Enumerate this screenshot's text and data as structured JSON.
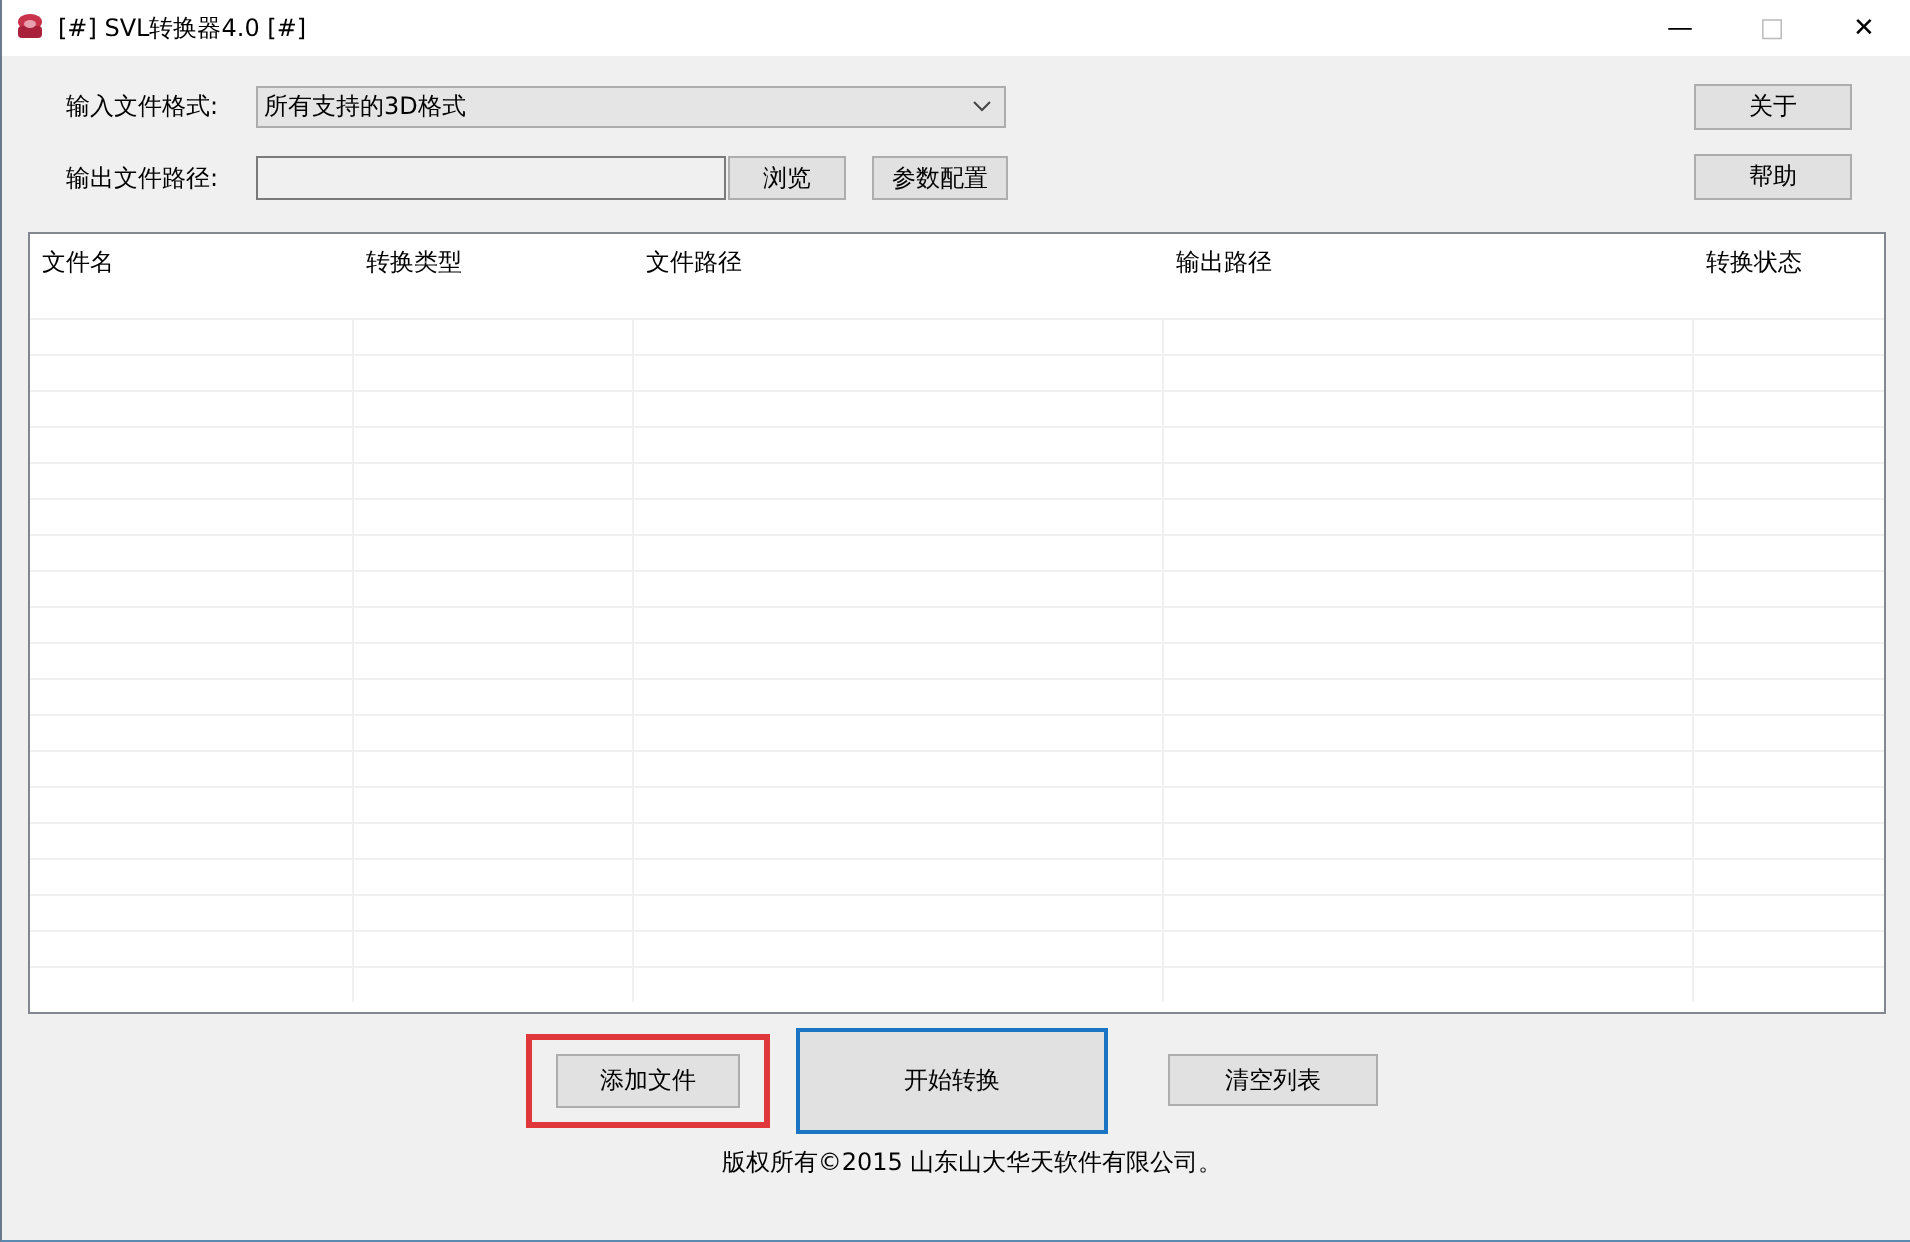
{
  "window": {
    "title": "[#] SVL转换器4.0 [#]",
    "controls": [
      "—",
      "□",
      "✕"
    ]
  },
  "input_format": {
    "label": "输入文件格式:",
    "value": "所有支持的3D格式"
  },
  "output_path": {
    "label": "输出文件路径:",
    "browse": "浏览",
    "settings": "参数配置"
  },
  "side_buttons": [
    "关于",
    "帮助"
  ],
  "table": {
    "columns": [
      "文件名",
      "转换类型",
      "文件路径",
      "输出路径",
      "转换状态"
    ]
  },
  "actions": [
    {
      "label": "添加文件",
      "highlighted": true,
      "focused": false
    },
    {
      "label": "开始转换",
      "highlighted": false,
      "focused": true
    },
    {
      "label": "清空列表",
      "highlighted": false,
      "focused": false
    }
  ],
  "footer": "版权所有©2015 山东山大华天软件有限公司。"
}
